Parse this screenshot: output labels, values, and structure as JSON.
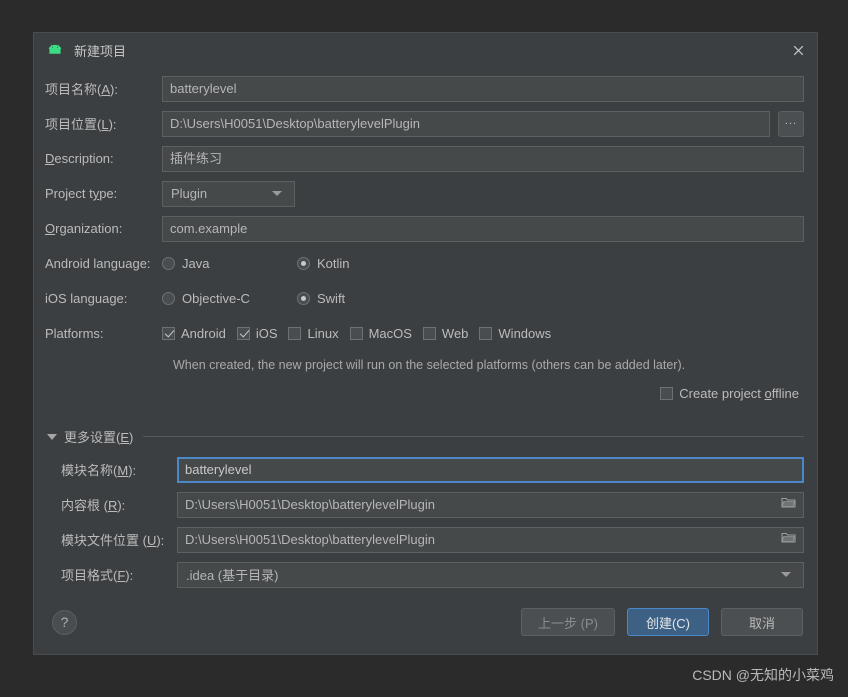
{
  "window": {
    "title": "新建项目",
    "app_icon": "android-icon",
    "close_icon": "close-icon"
  },
  "form": {
    "project_name": {
      "label": "项目名称(A):",
      "value": "batterylevel"
    },
    "project_location": {
      "label": "项目位置(L):",
      "value": "D:\\Users\\H0051\\Desktop\\batterylevelPlugin",
      "browse": "..."
    },
    "description": {
      "label": "Description:",
      "value": "插件练习"
    },
    "project_type": {
      "label": "Project type:",
      "value": "Plugin"
    },
    "organization": {
      "label": "Organization:",
      "value": "com.example"
    },
    "android_language": {
      "label": "Android language:",
      "options": [
        {
          "label": "Java",
          "selected": false
        },
        {
          "label": "Kotlin",
          "selected": true
        }
      ]
    },
    "ios_language": {
      "label": "iOS language:",
      "options": [
        {
          "label": "Objective-C",
          "selected": false
        },
        {
          "label": "Swift",
          "selected": true
        }
      ]
    },
    "platforms": {
      "label": "Platforms:",
      "options": [
        {
          "label": "Android",
          "checked": true
        },
        {
          "label": "iOS",
          "checked": true
        },
        {
          "label": "Linux",
          "checked": false
        },
        {
          "label": "MacOS",
          "checked": false
        },
        {
          "label": "Web",
          "checked": false
        },
        {
          "label": "Windows",
          "checked": false
        }
      ]
    },
    "note": "When created, the new project will run on the selected platforms (others can be added later).",
    "create_offline": {
      "label": "Create project offline",
      "checked": false
    }
  },
  "more_settings": {
    "label": "更多设置(E)",
    "expanded": true,
    "module_name": {
      "label": "模块名称(M):",
      "value": "batterylevel",
      "focused": true
    },
    "content_root": {
      "label": "内容根 (R):",
      "value": "D:\\Users\\H0051\\Desktop\\batterylevelPlugin",
      "icon": "folder-icon"
    },
    "module_file_location": {
      "label": "模块文件位置 (U):",
      "value": "D:\\Users\\H0051\\Desktop\\batterylevelPlugin",
      "icon": "folder-icon"
    },
    "project_format": {
      "label": "项目格式(F):",
      "value": ".idea (基于目录)"
    }
  },
  "buttons": {
    "help": "?",
    "previous": "上一步 (P)",
    "create": "创建(C)",
    "cancel": "取消"
  },
  "watermark": "CSDN @无知的小菜鸡",
  "colors": {
    "dialog_bg": "#3c3f41",
    "page_bg": "#2b2b2b",
    "field_bg": "#45494a",
    "accent": "#4a88c7",
    "primary_btn": "#3d6185",
    "android_green": "#3ddc84",
    "text": "#bbbbbb"
  }
}
